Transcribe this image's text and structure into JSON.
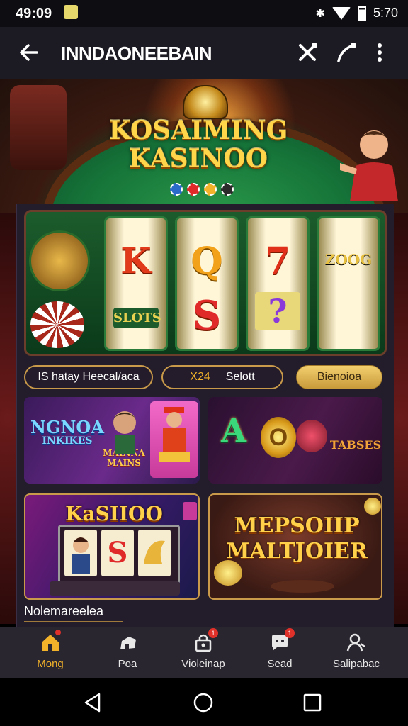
{
  "status_bar": {
    "time": "49:09",
    "right_text": "5:70",
    "icons": [
      "bluetooth-icon",
      "wifi-icon",
      "battery-icon"
    ]
  },
  "app_bar": {
    "title": "INNDAONEEBAIN",
    "back_icon": "back-arrow-icon",
    "actions": [
      "tools-icon",
      "pen-icon",
      "more-icon"
    ]
  },
  "hero": {
    "title_line1": "KOSAIMING",
    "title_line2": "KASINOO"
  },
  "slot": {
    "reel_symbols": [
      {
        "top": "K",
        "bottom": "SLOTS"
      },
      {
        "top": "Q",
        "bottom": "S"
      },
      {
        "top": "7",
        "bottom": "?"
      },
      {
        "top": "ZOOG",
        "bottom": ""
      }
    ]
  },
  "filters": {
    "pill1": "IS hatay Heecal/aca",
    "pill2_prefix": "X24",
    "pill2_label": "Selott",
    "pill3": "Bienoioa"
  },
  "cards": [
    {
      "title": "NGNOA",
      "subtitle": "INKIKES",
      "extra": "MAINNA MAINS"
    },
    {
      "title": "A",
      "subtitle": "TABSES",
      "extra": "O"
    },
    {
      "title": "KaSIIOO",
      "subtitle": "S",
      "extra": ""
    },
    {
      "title": "MEPSOIIP",
      "subtitle": "MALTJOIER",
      "extra": ""
    }
  ],
  "section_label": "Nolemareelea",
  "bottom_nav": [
    {
      "label": "Mong",
      "icon": "home-icon",
      "active": true,
      "badge": "1"
    },
    {
      "label": "Poa",
      "icon": "pie-icon",
      "active": false,
      "badge": ""
    },
    {
      "label": "Violeinap",
      "icon": "lock-icon",
      "active": false,
      "badge": "1"
    },
    {
      "label": "Sead",
      "icon": "chat-icon",
      "active": false,
      "badge": "1"
    },
    {
      "label": "Salipabac",
      "icon": "person-icon",
      "active": false,
      "badge": ""
    }
  ],
  "colors": {
    "accent_gold": "#f3cf6e",
    "nav_active": "#f2b32a",
    "app_bar": "#1c1a22"
  }
}
